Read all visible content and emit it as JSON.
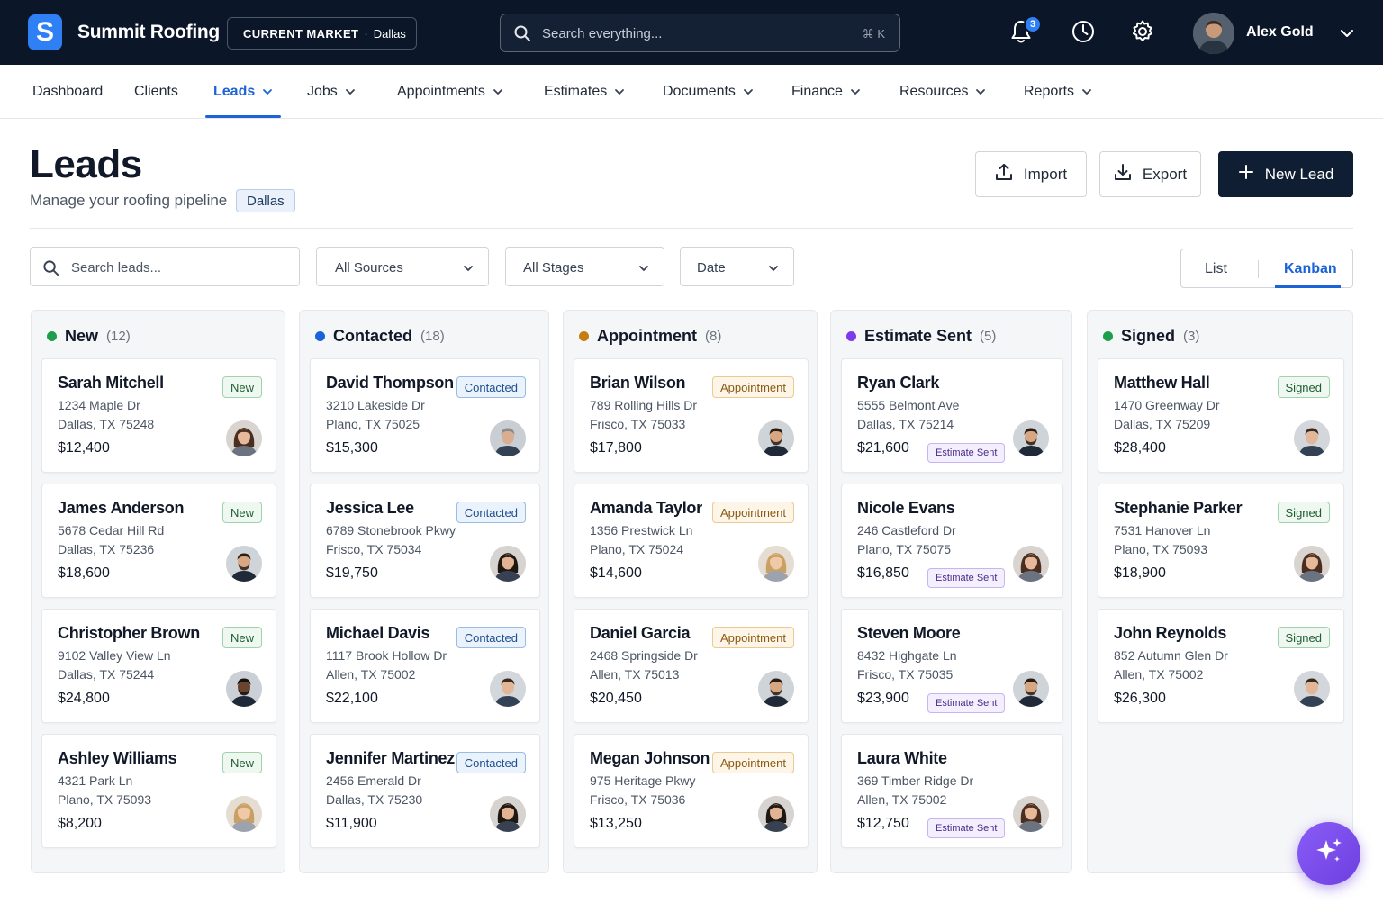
{
  "header": {
    "app_name": "Summit Roofing",
    "logo_letter": "S",
    "market_label": "CURRENT MARKET",
    "market_value": "Dallas",
    "search_placeholder": "Search everything...",
    "search_shortcut": "⌘ K",
    "notifications_count": "3",
    "user_name": "Alex Gold"
  },
  "nav": {
    "items": [
      {
        "label": "Dashboard",
        "has_menu": false
      },
      {
        "label": "Clients",
        "has_menu": false
      },
      {
        "label": "Leads",
        "has_menu": true,
        "active": true
      },
      {
        "label": "Jobs",
        "has_menu": true
      },
      {
        "label": "Appointments",
        "has_menu": true
      },
      {
        "label": "Estimates",
        "has_menu": true
      },
      {
        "label": "Documents",
        "has_menu": true
      },
      {
        "label": "Finance",
        "has_menu": true
      },
      {
        "label": "Resources",
        "has_menu": true
      },
      {
        "label": "Reports",
        "has_menu": true
      }
    ]
  },
  "page": {
    "title": "Leads",
    "subtitle": "Manage your roofing pipeline",
    "market_chip": "Dallas",
    "import_label": "Import",
    "export_label": "Export",
    "new_lead_label": "New Lead"
  },
  "filters": {
    "search_placeholder": "Search leads...",
    "sources": "All Sources",
    "stages": "All Stages",
    "date": "Date",
    "view_list": "List",
    "view_kanban": "Kanban",
    "active_view": "Kanban"
  },
  "colors": {
    "new": "#1f9d4a",
    "contacted": "#1d63d8",
    "appointment": "#c77c11",
    "estimate_sent": "#7c3aed",
    "signed": "#1f9d4a",
    "accent": "#1d63d8",
    "topbar": "#0b1728"
  },
  "columns": [
    {
      "title": "New",
      "count": "(12)",
      "badge_type": "new",
      "cards": [
        {
          "name": "Sarah Mitchell",
          "addr1": "1234 Maple Dr",
          "addr2": "Dallas, TX 75248",
          "value": "$12,400",
          "badge": "New",
          "avatar": "female-brown"
        },
        {
          "name": "James Anderson",
          "addr1": "5678 Cedar Hill Rd",
          "addr2": "Dallas, TX 75236",
          "value": "$18,600",
          "badge": "New",
          "avatar": "male-beard"
        },
        {
          "name": "Christopher Brown",
          "addr1": "9102 Valley View Ln",
          "addr2": "Dallas, TX 75244",
          "value": "$24,800",
          "badge": "New",
          "avatar": "male-dark"
        },
        {
          "name": "Ashley Williams",
          "addr1": "4321 Park Ln",
          "addr2": "Plano, TX 75093",
          "value": "$8,200",
          "badge": "New",
          "avatar": "female-blonde"
        }
      ]
    },
    {
      "title": "Contacted",
      "count": "(18)",
      "badge_type": "contacted",
      "cards": [
        {
          "name": "David Thompson",
          "addr1": "3210 Lakeside Dr",
          "addr2": "Plano, TX 75025",
          "value": "$15,300",
          "badge": "Contacted",
          "avatar": "male-grey"
        },
        {
          "name": "Jessica Lee",
          "addr1": "6789 Stonebrook Pkwy",
          "addr2": "Frisco, TX 75034",
          "value": "$19,750",
          "badge": "Contacted",
          "avatar": "female-dark"
        },
        {
          "name": "Michael Davis",
          "addr1": "1117 Brook Hollow Dr",
          "addr2": "Allen, TX 75002",
          "value": "$22,100",
          "badge": "Contacted",
          "avatar": "male-light"
        },
        {
          "name": "Jennifer Martinez",
          "addr1": "2456 Emerald Dr",
          "addr2": "Dallas, TX 75230",
          "value": "$11,900",
          "badge": "Contacted",
          "avatar": "female-dark"
        }
      ]
    },
    {
      "title": "Appointment",
      "count": "(8)",
      "badge_type": "appointment",
      "cards": [
        {
          "name": "Brian Wilson",
          "addr1": "789 Rolling Hills Dr",
          "addr2": "Frisco, TX 75033",
          "value": "$17,800",
          "badge": "Appointment",
          "avatar": "male-beard"
        },
        {
          "name": "Amanda Taylor",
          "addr1": "1356 Prestwick Ln",
          "addr2": "Plano, TX 75024",
          "value": "$14,600",
          "badge": "Appointment",
          "avatar": "female-blonde"
        },
        {
          "name": "Daniel Garcia",
          "addr1": "2468 Springside Dr",
          "addr2": "Allen, TX 75013",
          "value": "$20,450",
          "badge": "Appointment",
          "avatar": "male-beard"
        },
        {
          "name": "Megan Johnson",
          "addr1": "975 Heritage Pkwy",
          "addr2": "Frisco, TX 75036",
          "value": "$13,250",
          "badge": "Appointment",
          "avatar": "female-dark"
        }
      ]
    },
    {
      "title": "Estimate Sent",
      "count": "(5)",
      "badge_type": "estimate",
      "cards": [
        {
          "name": "Ryan Clark",
          "addr1": "5555 Belmont Ave",
          "addr2": "Dallas, TX 75214",
          "value": "$21,600",
          "badge": "Estimate Sent",
          "avatar": "male-beard"
        },
        {
          "name": "Nicole Evans",
          "addr1": "246 Castleford Dr",
          "addr2": "Plano, TX 75075",
          "value": "$16,850",
          "badge": "Estimate Sent",
          "avatar": "female-brown"
        },
        {
          "name": "Steven Moore",
          "addr1": "8432 Highgate Ln",
          "addr2": "Frisco, TX 75035",
          "value": "$23,900",
          "badge": "Estimate Sent",
          "avatar": "male-beard"
        },
        {
          "name": "Laura White",
          "addr1": "369 Timber Ridge Dr",
          "addr2": "Allen, TX 75002",
          "value": "$12,750",
          "badge": "Estimate Sent",
          "avatar": "female-brown"
        }
      ]
    },
    {
      "title": "Signed",
      "count": "(3)",
      "badge_type": "signed",
      "cards": [
        {
          "name": "Matthew Hall",
          "addr1": "1470 Greenway Dr",
          "addr2": "Dallas, TX 75209",
          "value": "$28,400",
          "badge": "Signed",
          "avatar": "male-light"
        },
        {
          "name": "Stephanie Parker",
          "addr1": "7531 Hanover Ln",
          "addr2": "Plano, TX 75093",
          "value": "$18,900",
          "badge": "Signed",
          "avatar": "female-brown"
        },
        {
          "name": "John Reynolds",
          "addr1": "852 Autumn Glen Dr",
          "addr2": "Allen, TX 75002",
          "value": "$26,300",
          "badge": "Signed",
          "avatar": "male-light"
        }
      ]
    }
  ]
}
